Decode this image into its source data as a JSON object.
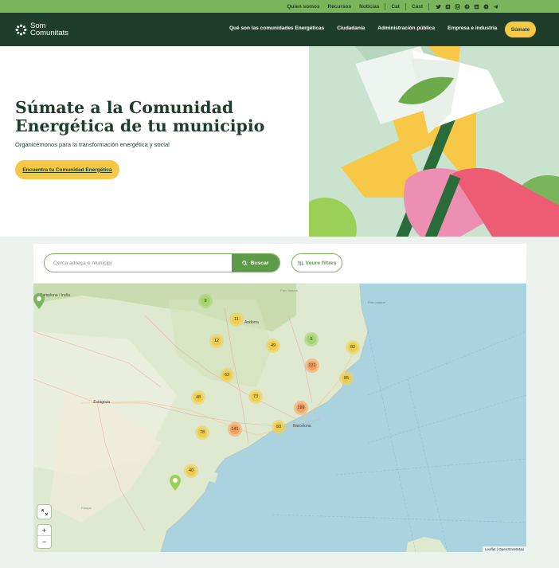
{
  "topbar": {
    "links": [
      "Quien somos",
      "Recursos",
      "Noticias",
      "Cat",
      "Cast"
    ],
    "social_icons": [
      "twitter-icon",
      "mastodon-icon",
      "instagram-icon",
      "facebook-icon",
      "linkedin-icon",
      "youtube-icon",
      "telegram-icon"
    ]
  },
  "header": {
    "logo_line1": "Som",
    "logo_line2": "Comunitats",
    "nav": [
      "Qué son las comunidades Energéticas",
      "Ciudadanía",
      "Administración pública",
      "Empresa e industria"
    ],
    "join_label": "Súmate"
  },
  "hero": {
    "title": "Súmate a la Comunidad Energética de tu municipio",
    "subtitle": "Organicémonos para la transformación energética y social",
    "cta_label": "Encuentra tu Comunidad Energética"
  },
  "search": {
    "placeholder": "Cerca adreça o municipi",
    "button_label": "Buscar",
    "filters_label": "Veure filtres"
  },
  "map": {
    "clusters": [
      {
        "label": "9",
        "kind": "g"
      },
      {
        "label": "11",
        "kind": "y"
      },
      {
        "label": "12",
        "kind": "y"
      },
      {
        "label": "49",
        "kind": "y"
      },
      {
        "label": "5",
        "kind": "g"
      },
      {
        "label": "82",
        "kind": "y"
      },
      {
        "label": "121",
        "kind": "o"
      },
      {
        "label": "63",
        "kind": "y"
      },
      {
        "label": "85",
        "kind": "y"
      },
      {
        "label": "48",
        "kind": "y"
      },
      {
        "label": "73",
        "kind": "y"
      },
      {
        "label": "199",
        "kind": "o"
      },
      {
        "label": "78",
        "kind": "y"
      },
      {
        "label": "141",
        "kind": "o"
      },
      {
        "label": "83",
        "kind": "y"
      },
      {
        "label": "40",
        "kind": "y"
      }
    ],
    "place_labels": [
      "Pamplona / Iruña",
      "Andorra",
      "Zaragoza",
      "Barcelona"
    ],
    "attribution": "Leaflet | OpenStreetMap",
    "zoom_in": "+",
    "zoom_out": "−"
  },
  "colors": {
    "topbar": "#7ab55c",
    "header": "#1f3d2b",
    "accent_yellow": "#f6c845",
    "green": "#5d9a4a",
    "sea": "#aad3df"
  }
}
